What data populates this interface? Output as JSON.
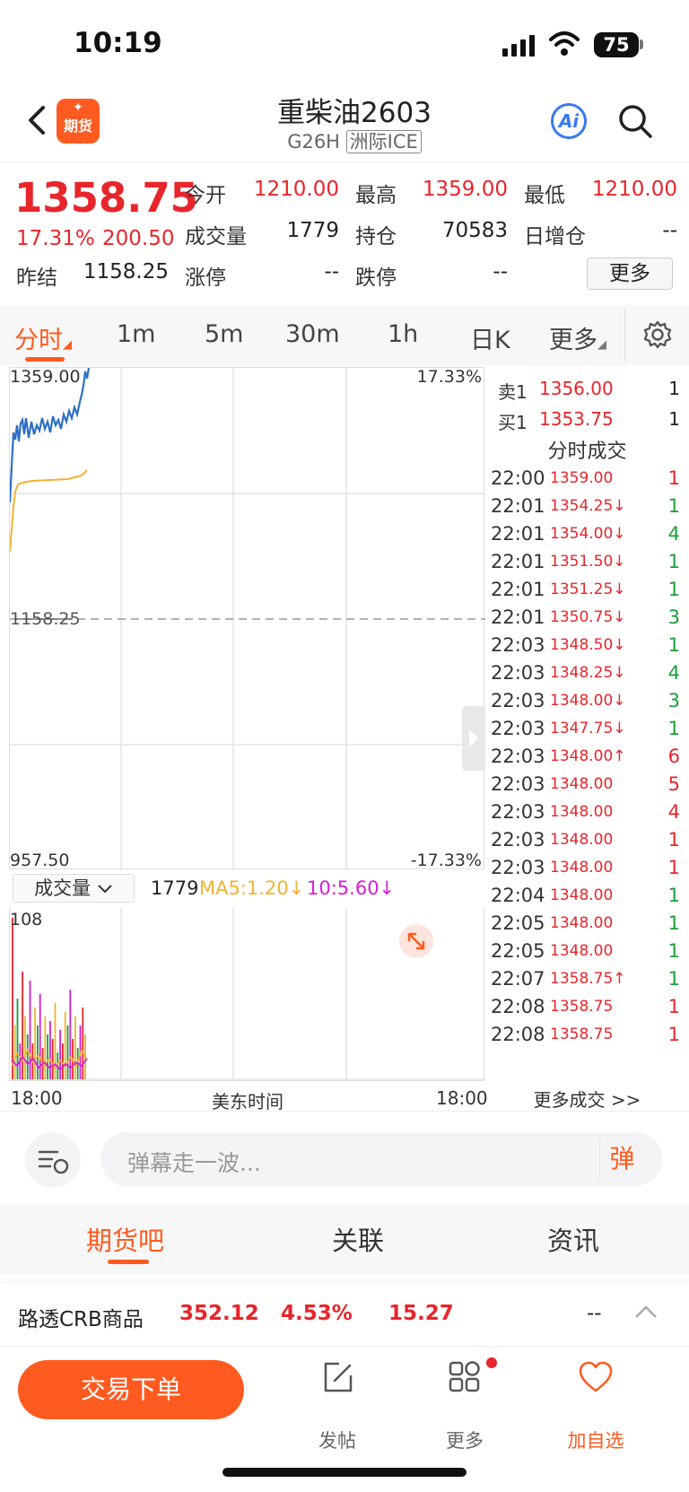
{
  "status": {
    "time": "10:19",
    "battery": "75"
  },
  "nav": {
    "logo_top": "✦",
    "logo_label": "期货",
    "title": "重柴油2603",
    "code": "G26H",
    "exchange": "洲际ICE",
    "ai_label": "Ai"
  },
  "quote": {
    "price": "1358.75",
    "pct": "17.31%",
    "change": "200.50",
    "fields": [
      {
        "label": "今开",
        "value": "1210.00"
      },
      {
        "label": "最高",
        "value": "1359.00"
      },
      {
        "label": "最低",
        "value": "1210.00"
      },
      {
        "label": "成交量",
        "value": "1779"
      },
      {
        "label": "持仓",
        "value": "70583"
      },
      {
        "label": "日增仓",
        "value": "--"
      },
      {
        "label": "昨结",
        "value": "1158.25"
      },
      {
        "label": "涨停",
        "value": "--"
      },
      {
        "label": "跌停",
        "value": "--"
      }
    ],
    "more": "更多"
  },
  "tabs": [
    "分时",
    "1m",
    "5m",
    "30m",
    "1h",
    "日K",
    "更多"
  ],
  "chart": {
    "top_price": "1359.00",
    "top_pct": "17.33%",
    "mid_price": "1158.25",
    "bottom_price": "957.50",
    "bottom_pct": "-17.33%",
    "volume_selector": "成交量",
    "volume_value": "1779",
    "ma5": "MA5:1.20↓",
    "ma10": "10:5.60↓",
    "vol_max": "108",
    "time_start": "18:00",
    "time_mid": "美东时间",
    "time_end": "18:00"
  },
  "orderbook": {
    "sell": {
      "label": "卖1",
      "price": "1356.00",
      "vol": "1"
    },
    "buy": {
      "label": "买1",
      "price": "1353.75",
      "vol": "1"
    },
    "title": "分时成交",
    "trades": [
      {
        "t": "22:00",
        "p": "1359.00",
        "v": "1",
        "c": "red"
      },
      {
        "t": "22:01",
        "p": "1354.25↓",
        "v": "1",
        "c": "green"
      },
      {
        "t": "22:01",
        "p": "1354.00↓",
        "v": "4",
        "c": "green"
      },
      {
        "t": "22:01",
        "p": "1351.50↓",
        "v": "1",
        "c": "green"
      },
      {
        "t": "22:01",
        "p": "1351.25↓",
        "v": "1",
        "c": "green"
      },
      {
        "t": "22:01",
        "p": "1350.75↓",
        "v": "3",
        "c": "green"
      },
      {
        "t": "22:03",
        "p": "1348.50↓",
        "v": "1",
        "c": "green"
      },
      {
        "t": "22:03",
        "p": "1348.25↓",
        "v": "4",
        "c": "green"
      },
      {
        "t": "22:03",
        "p": "1348.00↓",
        "v": "3",
        "c": "green"
      },
      {
        "t": "22:03",
        "p": "1347.75↓",
        "v": "1",
        "c": "green"
      },
      {
        "t": "22:03",
        "p": "1348.00↑",
        "v": "6",
        "c": "red"
      },
      {
        "t": "22:03",
        "p": "1348.00",
        "v": "5",
        "c": "red"
      },
      {
        "t": "22:03",
        "p": "1348.00",
        "v": "4",
        "c": "red"
      },
      {
        "t": "22:03",
        "p": "1348.00",
        "v": "1",
        "c": "red"
      },
      {
        "t": "22:03",
        "p": "1348.00",
        "v": "1",
        "c": "red"
      },
      {
        "t": "22:04",
        "p": "1348.00",
        "v": "1",
        "c": "green"
      },
      {
        "t": "22:05",
        "p": "1348.00",
        "v": "1",
        "c": "green"
      },
      {
        "t": "22:05",
        "p": "1348.00",
        "v": "1",
        "c": "green"
      },
      {
        "t": "22:07",
        "p": "1358.75↑",
        "v": "1",
        "c": "green"
      },
      {
        "t": "22:08",
        "p": "1358.75",
        "v": "1",
        "c": "red"
      },
      {
        "t": "22:08",
        "p": "1358.75",
        "v": "1",
        "c": "red"
      }
    ],
    "more_trades": "更多成交 >>"
  },
  "danmu": {
    "placeholder": "弹幕走一波...",
    "button": "弹"
  },
  "bottom_tabs": [
    "期货吧",
    "关联",
    "资讯"
  ],
  "crb": {
    "name": "路透CRB商品",
    "price": "352.12",
    "pct": "4.53%",
    "change": "15.27",
    "extra": "--"
  },
  "bottom_bar": {
    "trade": "交易下单",
    "post": "发帖",
    "more": "更多",
    "watch": "加自选"
  },
  "colors": {
    "accent": "#ff5a1f",
    "up": "#e8252b",
    "down": "#1a9e3a",
    "price_line": "#2f6fc4",
    "avg_line": "#f2b234",
    "ma10": "#d61ed6"
  }
}
